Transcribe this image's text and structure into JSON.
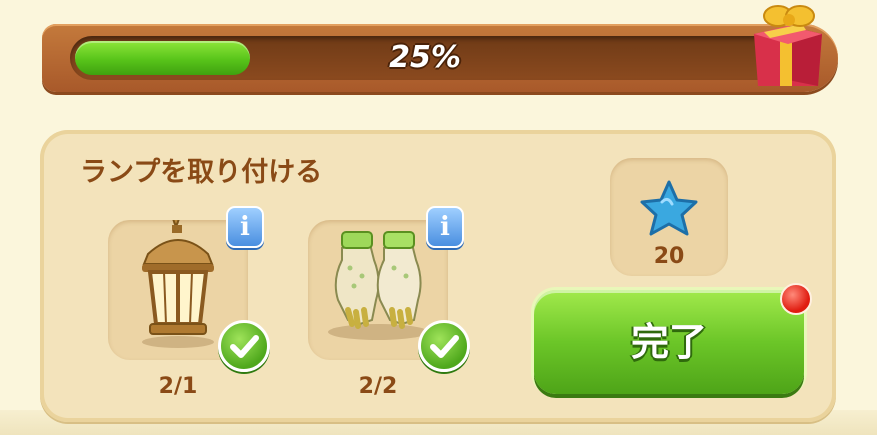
{
  "progress": {
    "label": "25%",
    "fraction": 0.25
  },
  "task": {
    "title": "ランプを取り付ける",
    "items": [
      {
        "name": "lantern",
        "count": "2/1",
        "info": "i",
        "done": true
      },
      {
        "name": "gloves",
        "count": "2/2",
        "info": "i",
        "done": true
      }
    ],
    "reward": {
      "icon": "blue-star-icon",
      "amount": "20"
    },
    "complete_label": "完了"
  },
  "colors": {
    "progress_green": "#58c41a",
    "frame_brown": "#a8592a",
    "title_brown": "#8a4a16",
    "button_green": "#6cc628",
    "info_blue": "#4a8fe0",
    "notify_red": "#e01c10"
  }
}
